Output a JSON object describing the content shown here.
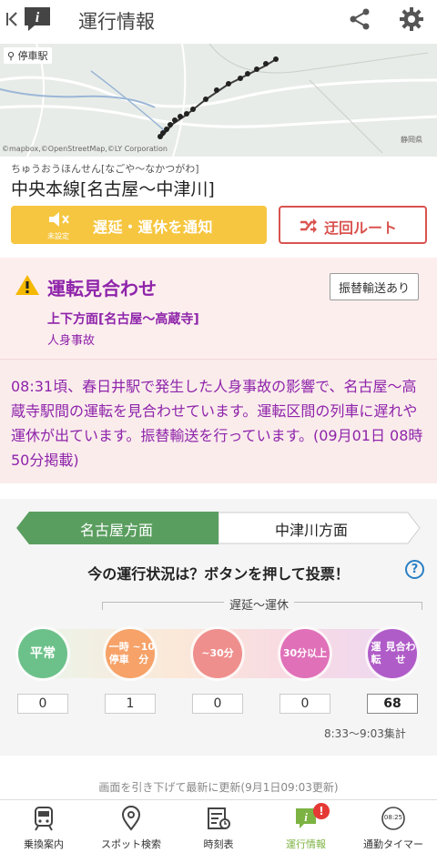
{
  "header": {
    "title": "運行情報"
  },
  "map": {
    "label": "停車駅",
    "credit": "©mapbox,©OpenStreetMap,©LY Corporation",
    "city": "静岡県"
  },
  "line": {
    "furigana": "ちゅうおうほんせん[なごや～なかつがわ]",
    "name": "中央本線[名古屋～中津川]"
  },
  "actions": {
    "notify_label": "遅延・運休を通知",
    "unset_label": "未設定",
    "detour_label": "迂回ルート"
  },
  "alert": {
    "title": "運転見合わせ",
    "transfer_badge": "振替輸送あり",
    "direction": "上下方面[名古屋～高蔵寺]",
    "cause": "人身事故",
    "body": "08:31頃、春日井駅で発生した人身事故の影響で、名古屋～高蔵寺駅間の運転を見合わせています。運転区間の列車に遅れや運休が出ています。振替輸送を行っています。(09月01日 08時50分掲載)"
  },
  "vote": {
    "tabs": [
      {
        "label": "名古屋方面",
        "active": true
      },
      {
        "label": "中津川方面",
        "active": false
      }
    ],
    "question": "今の運行状況は？ボタンを押して投票！",
    "help": "?",
    "range_label": "遅延～運休",
    "options": [
      {
        "label": "平常",
        "count": "0",
        "color": "#6cc18a"
      },
      {
        "label": "一時停車\n~10分",
        "count": "1",
        "color": "#f6a268"
      },
      {
        "label": "~30分",
        "count": "0",
        "color": "#ef8f8d"
      },
      {
        "label": "30分\n以上",
        "count": "0",
        "color": "#e070b8"
      },
      {
        "label": "運転\n見合わせ",
        "count": "68",
        "color": "#b05cc8"
      }
    ],
    "period": "8:33〜9:03集計"
  },
  "refresh_hint": "画面を引き下げて最新に更新(9月1日09:03更新)",
  "nav": [
    {
      "label": "乗換案内",
      "icon": "train-icon"
    },
    {
      "label": "スポット検索",
      "icon": "map-pin-icon"
    },
    {
      "label": "時刻表",
      "icon": "timetable-icon"
    },
    {
      "label": "運行情報",
      "icon": "info-icon",
      "badge": "!"
    },
    {
      "label": "通勤タイマー",
      "icon": "timer-icon",
      "time": "08:25"
    }
  ]
}
